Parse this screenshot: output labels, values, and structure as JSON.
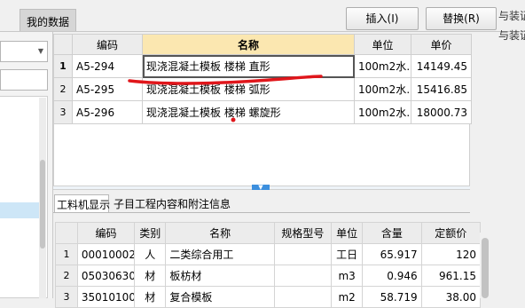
{
  "header": {
    "tab_label": "我的数据",
    "insert_label": "插入(I)",
    "replace_label": "替换(R)",
    "edge_text_1": "与装证",
    "edge_text_2": "与装证"
  },
  "quota_grid": {
    "columns": [
      "编码",
      "名称",
      "单位",
      "单价"
    ],
    "rows": [
      {
        "index": "1",
        "code": "A5-294",
        "name": "现浇混凝土模板 楼梯 直形",
        "unit": "100m2水…",
        "price": "14149.45"
      },
      {
        "index": "2",
        "code": "A5-295",
        "name": "现浇混凝土模板 楼梯 弧形",
        "unit": "100m2水…",
        "price": "15416.85"
      },
      {
        "index": "3",
        "code": "A5-296",
        "name": "现浇混凝土模板 楼梯 螺旋形",
        "unit": "100m2水…",
        "price": "18000.73"
      }
    ]
  },
  "lower_tabs": {
    "labor_materials": "工料机显示",
    "sub_item_info": "子目工程内容和附注信息"
  },
  "resource_grid": {
    "columns": [
      "编码",
      "类别",
      "名称",
      "规格型号",
      "单位",
      "含量",
      "定额价"
    ],
    "rows": [
      {
        "index": "1",
        "code": "00010002",
        "category": "人",
        "name": "二类综合用工",
        "spec": "",
        "unit": "工日",
        "qty": "65.917",
        "price": "120"
      },
      {
        "index": "2",
        "code": "05030630",
        "category": "材",
        "name": "板枋材",
        "spec": "",
        "unit": "m3",
        "qty": "0.946",
        "price": "961.15"
      },
      {
        "index": "3",
        "code": "35010100",
        "category": "材",
        "name": "复合模板",
        "spec": "",
        "unit": "m2",
        "qty": "58.719",
        "price": "38.00"
      }
    ]
  },
  "colors": {
    "name_header_bg": "#fbe7b0",
    "annotation_red": "#e0161b",
    "splitter_blue": "#3c8fde"
  }
}
